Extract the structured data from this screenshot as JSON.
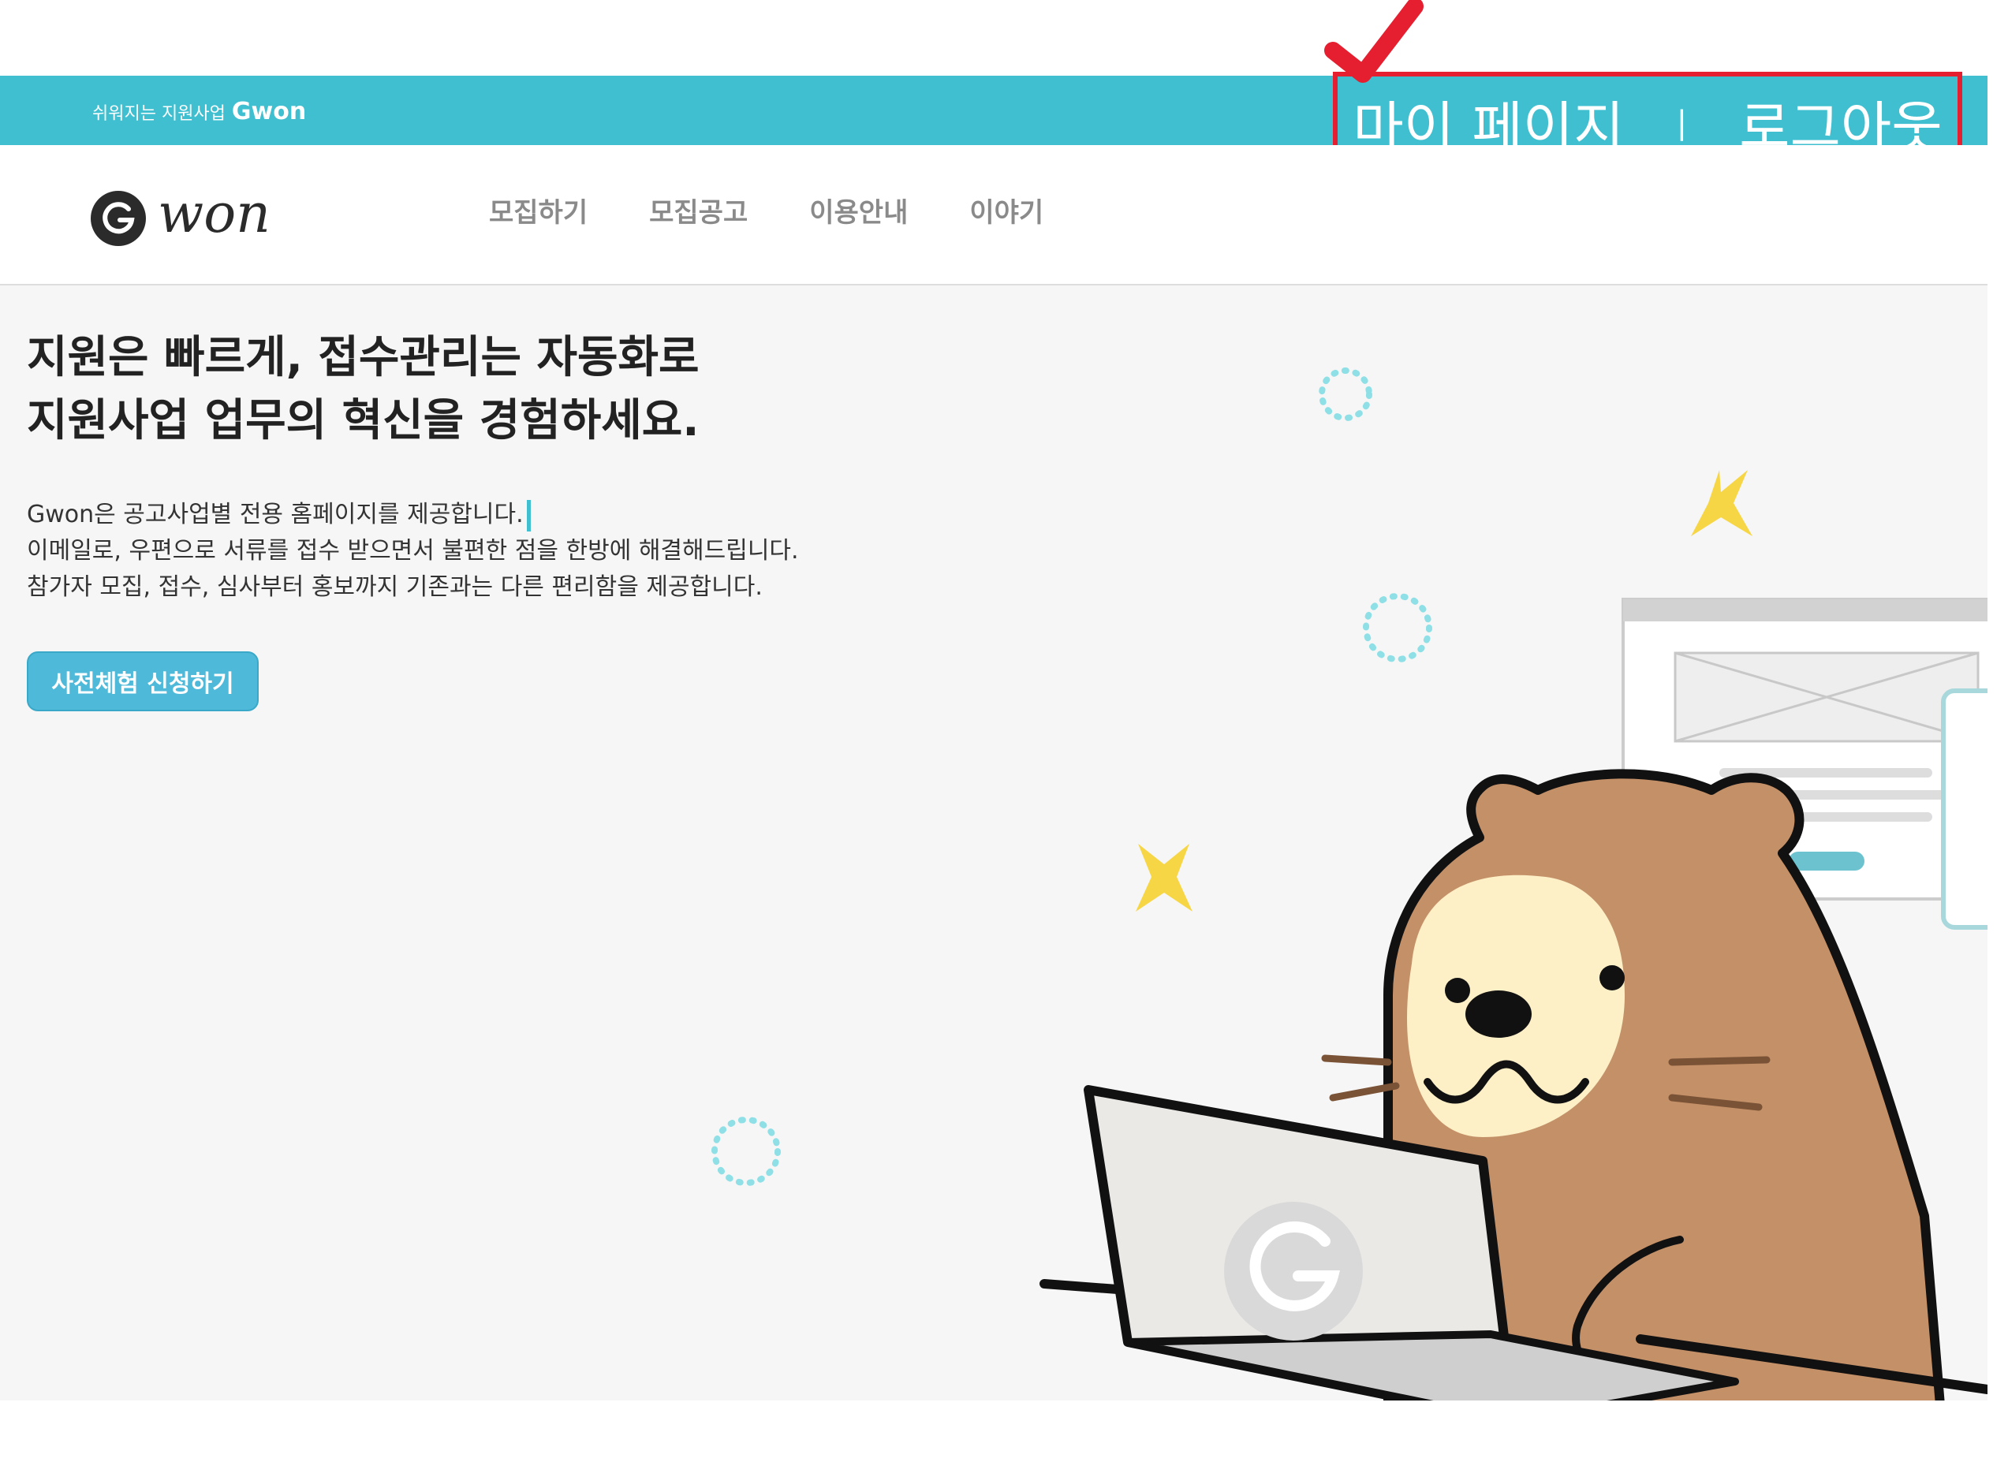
{
  "topbar": {
    "tagline_prefix": "쉬워지는 지원사업",
    "tagline_brand": "Gwon",
    "my_page": "마이 페이지",
    "separator": "|",
    "logout": "로그아웃"
  },
  "header": {
    "logo_alt": "Gwon logo",
    "nav": [
      "모집하기",
      "모집공고",
      "이용안내",
      "이야기"
    ]
  },
  "hero": {
    "headline": [
      "지원은 빠르게, 접수관리는 자동화로",
      "지원사업 업무의 혁신을 경험하세요."
    ],
    "description": [
      "Gwon은 공고사업별 전용 홈페이지를 제공합니다.",
      "이메일로, 우편으로 서류를 접수 받으면서 불편한 점을 한방에 해결해드립니다.",
      "참가자 모집, 접수, 심사부터 홍보까지 기존과는 다른 편리함을 제공합니다."
    ],
    "cta": "사전체험 신청하기"
  },
  "colors": {
    "topbar": "#3fbfcf",
    "highlight_border": "#e51f2f",
    "cta": "#4fb9d9",
    "hero_bg": "#f6f6f6",
    "otter_brown": "#c49068",
    "otter_cream": "#fdefc6",
    "star_yellow": "#f7d646"
  },
  "icons": {
    "checkmark": "check-icon",
    "logo_mark": "g-logo-icon"
  }
}
